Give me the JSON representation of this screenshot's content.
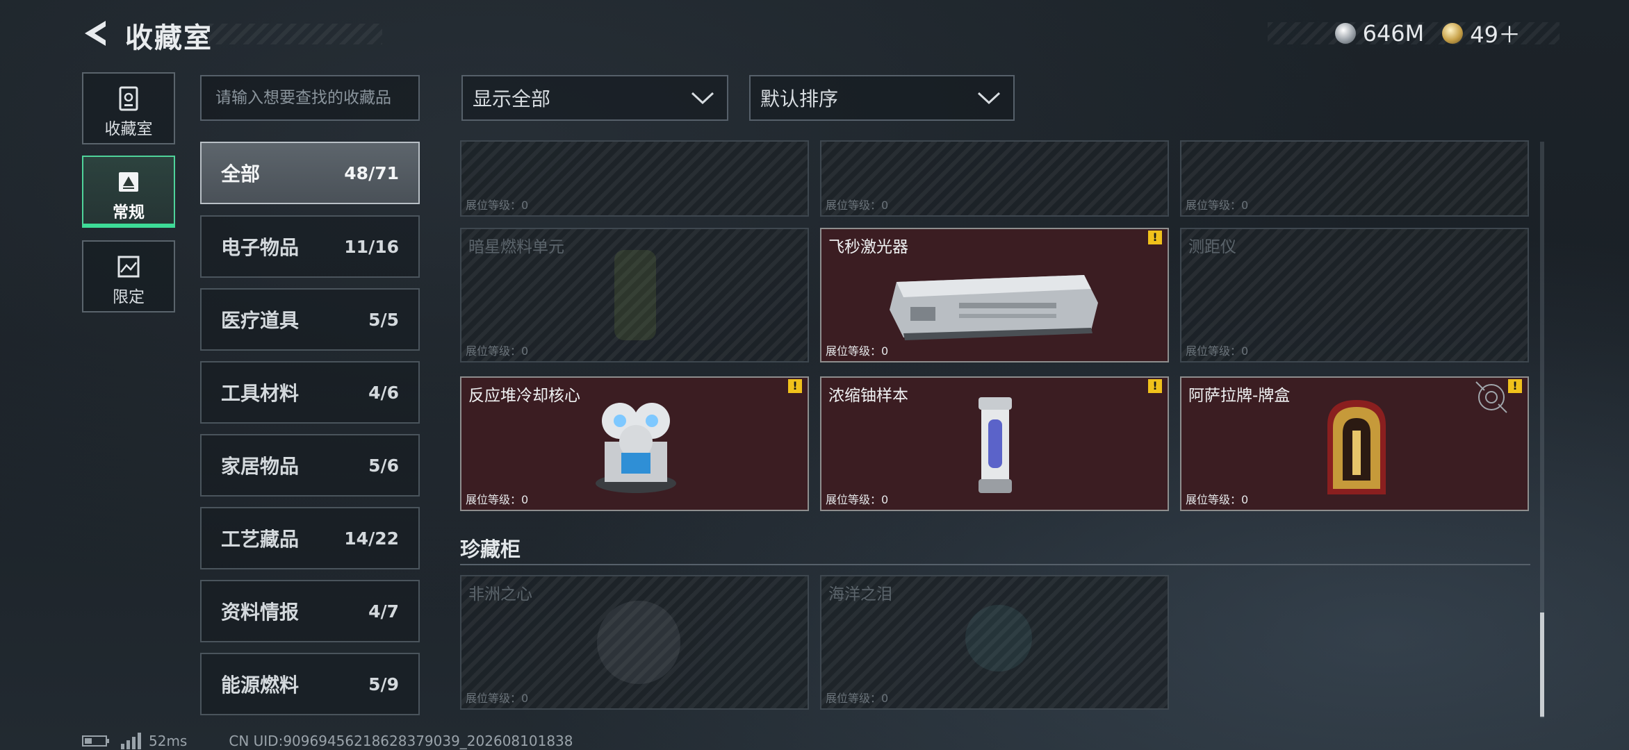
{
  "header": {
    "title": "收藏室",
    "currencies": [
      {
        "icon": "silver-coin-icon",
        "value": "646M"
      },
      {
        "icon": "gold-coin-icon",
        "value": "49＋"
      }
    ]
  },
  "nav": {
    "items": [
      {
        "label": "收藏室",
        "icon": "vault-icon",
        "active": false
      },
      {
        "label": "常规",
        "icon": "certificate-icon",
        "active": true
      },
      {
        "label": "限定",
        "icon": "picture-icon",
        "active": false
      }
    ]
  },
  "search": {
    "placeholder": "请输入想要查找的收藏品",
    "value": ""
  },
  "categories": [
    {
      "name": "全部",
      "count": "48/71",
      "active": true
    },
    {
      "name": "电子物品",
      "count": "11/16"
    },
    {
      "name": "医疗道具",
      "count": "5/5"
    },
    {
      "name": "工具材料",
      "count": "4/6"
    },
    {
      "name": "家居物品",
      "count": "5/6"
    },
    {
      "name": "工艺藏品",
      "count": "14/22"
    },
    {
      "name": "资料情报",
      "count": "4/7"
    },
    {
      "name": "能源燃料",
      "count": "5/9"
    }
  ],
  "filters": {
    "display": "显示全部",
    "sort": "默认排序"
  },
  "level_label": "展位等级：0",
  "items": [
    {
      "name": "",
      "locked": true
    },
    {
      "name": "",
      "locked": true
    },
    {
      "name": "",
      "locked": true
    },
    {
      "name": "暗星燃料单元",
      "locked": true
    },
    {
      "name": "飞秒激光器",
      "locked": false,
      "alert": true
    },
    {
      "name": "测距仪",
      "locked": true
    },
    {
      "name": "反应堆冷却核心",
      "locked": false,
      "alert": true
    },
    {
      "name": "浓缩铀样本",
      "locked": false,
      "alert": true
    },
    {
      "name": "阿萨拉牌-牌盒",
      "locked": false,
      "alert": true
    }
  ],
  "cabinet": {
    "title": "珍藏柜",
    "items": [
      {
        "name": "非洲之心",
        "locked": true
      },
      {
        "name": "海洋之泪",
        "locked": true
      }
    ]
  },
  "footer": {
    "ping": "52ms",
    "uid": "CN UID:9096945621862837903​9_202608101838"
  },
  "colors": {
    "accent": "#3ddc97",
    "owned_bg": "#3b1d22",
    "alert": "#f1c21b"
  }
}
